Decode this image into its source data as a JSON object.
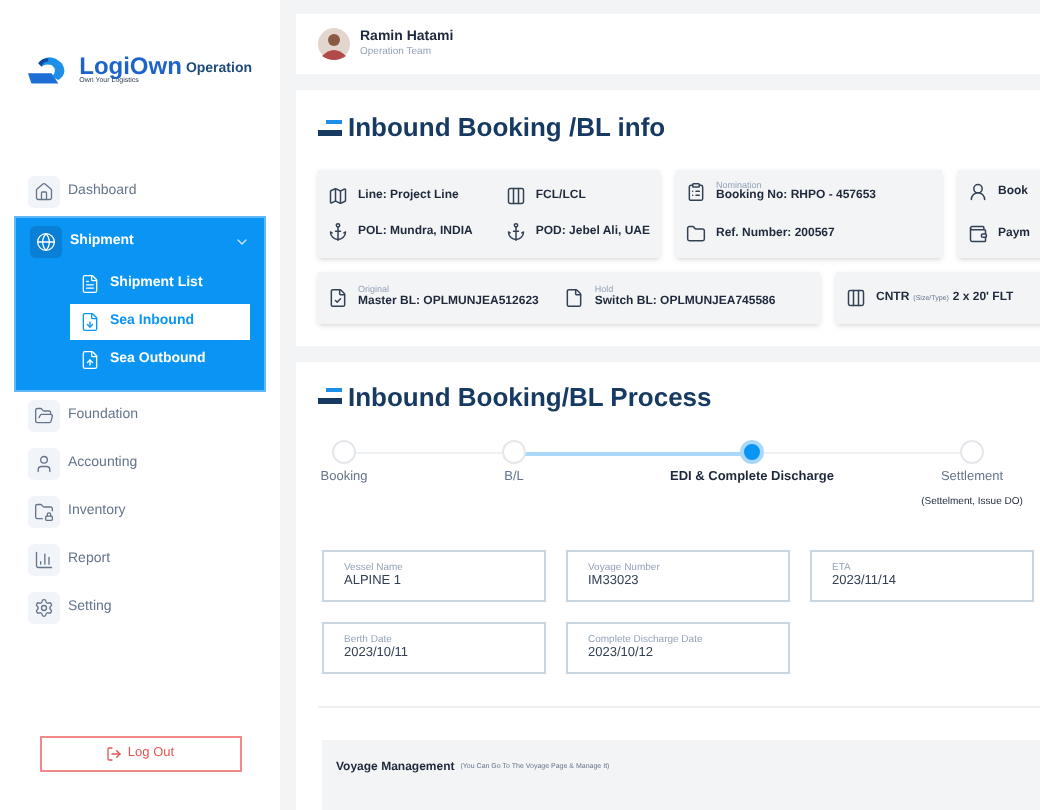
{
  "sidebar": {
    "logo": {
      "name": "LogiOwn",
      "tagline": "Own Your Logistics"
    },
    "section": "Operation",
    "items": [
      {
        "label": "Dashboard",
        "selected": false
      },
      {
        "label": "Shipment",
        "selected": true,
        "expanded": true,
        "children": [
          {
            "label": "Shipment List",
            "selected": false
          },
          {
            "label": "Sea Inbound",
            "selected": true
          },
          {
            "label": "Sea Outbound",
            "selected": false
          }
        ]
      },
      {
        "label": "Foundation",
        "selected": false
      },
      {
        "label": "Accounting",
        "selected": false
      },
      {
        "label": "Inventory",
        "selected": false
      },
      {
        "label": "Report",
        "selected": false
      },
      {
        "label": "Setting",
        "selected": false
      }
    ],
    "logout": "Log Out"
  },
  "user": {
    "name": "Ramin Hatami",
    "role": "Operation Team"
  },
  "booking_info": {
    "title": "Inbound Booking /BL info",
    "cards_row1": [
      {
        "items": [
          {
            "text": "Line: Project Line"
          },
          {
            "text": "FCL/LCL"
          },
          {
            "text": "POL: Mundra, INDIA"
          },
          {
            "text": "POD: Jebel Ali, UAE"
          }
        ]
      },
      {
        "items": [
          {
            "caption": "Nomination",
            "text": "Booking No: RHPO - 457653"
          },
          {
            "text": "Ref. Number: 200567"
          }
        ]
      },
      {
        "items": [
          {
            "text": "Book"
          },
          {
            "text": "Paym"
          }
        ]
      }
    ],
    "cards_row2": [
      {
        "items": [
          {
            "caption": "Original",
            "text": "Master BL: OPLMUNJEA512623"
          },
          {
            "caption": "Hold",
            "text": "Switch BL: OPLMUNJEA745586"
          }
        ]
      },
      {
        "items": [
          {
            "text": "CNTR",
            "note": "(Size/Type)",
            "value": "2 x 20' FLT"
          }
        ]
      }
    ]
  },
  "process": {
    "title": "Inbound Booking/BL Process",
    "steps": [
      {
        "label": "Booking",
        "selected": false
      },
      {
        "label": "B/L",
        "selected": false
      },
      {
        "label": "EDI & Complete Discharge",
        "selected": true
      },
      {
        "label": "Settlement",
        "sub": "(Settelment, Issue DO)",
        "selected": false
      }
    ],
    "fields": [
      {
        "label": "Vessel Name",
        "value": "ALPINE 1"
      },
      {
        "label": "Voyage Number",
        "value": "IM33023"
      },
      {
        "label": "ETA",
        "value": "2023/11/14"
      },
      {
        "label": "Berth Date",
        "value": "2023/10/11"
      },
      {
        "label": "Complete Discharge Date",
        "value": "2023/10/12"
      }
    ],
    "voyage": {
      "title": "Voyage Management",
      "note": "(You Can Go To The Voyage Page & Manage It)"
    }
  }
}
